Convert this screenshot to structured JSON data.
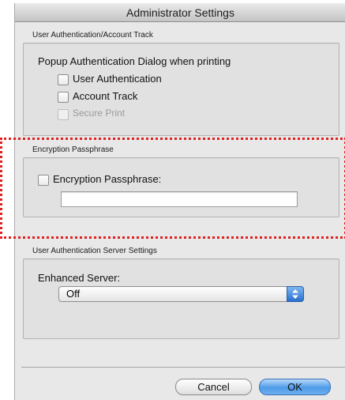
{
  "window": {
    "title": "Administrator Settings"
  },
  "user_auth_account_track": {
    "section_label": "User Authentication/Account Track",
    "group_heading": "Popup Authentication Dialog when printing",
    "checkboxes": [
      {
        "label": "User Authentication",
        "checked": false,
        "enabled": true
      },
      {
        "label": "Account Track",
        "checked": false,
        "enabled": true
      },
      {
        "label": "Secure Print",
        "checked": false,
        "enabled": false
      }
    ]
  },
  "encryption": {
    "section_label": "Encryption Passphrase",
    "checkbox_label": "Encryption Passphrase:",
    "checked": false,
    "field_value": ""
  },
  "server_settings": {
    "section_label": "User Authentication Server Settings",
    "field_label": "Enhanced Server:",
    "selected_value": "Off"
  },
  "buttons": {
    "cancel": "Cancel",
    "ok": "OK"
  },
  "colors": {
    "highlight": "#e02020",
    "default_button": "#4e9be8"
  }
}
